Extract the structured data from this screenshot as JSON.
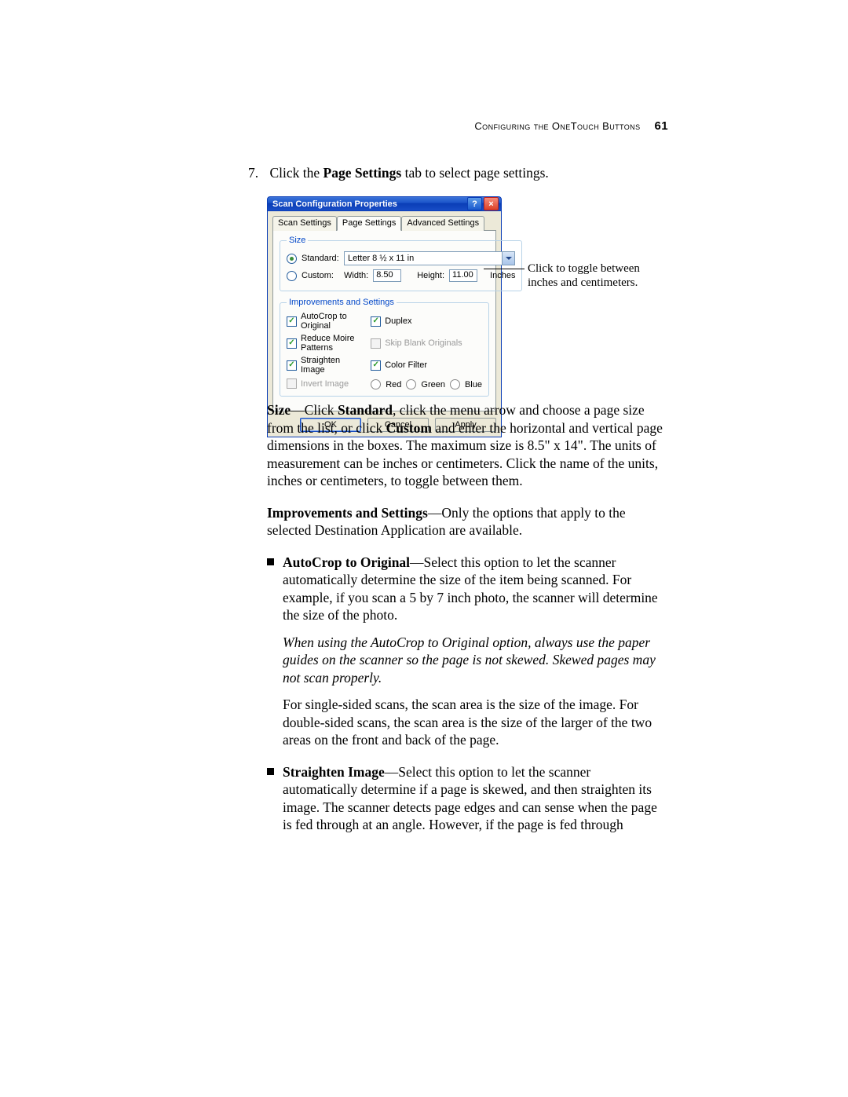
{
  "header": {
    "title": "Configuring the OneTouch Buttons",
    "page_number": "61"
  },
  "step": {
    "number": "7.",
    "text_before": "Click the ",
    "bold": "Page Settings",
    "text_after": " tab to select page settings."
  },
  "dialog": {
    "title": "Scan Configuration Properties",
    "tabs": {
      "scan": "Scan Settings",
      "page": "Page Settings",
      "advanced": "Advanced Settings"
    },
    "size": {
      "legend": "Size",
      "standard_label": "Standard:",
      "standard_value": "Letter 8 ½ x 11 in",
      "custom_label": "Custom:",
      "width_label": "Width:",
      "width_value": "8.50",
      "height_label": "Height:",
      "height_value": "11.00",
      "units": "Inches"
    },
    "improvements": {
      "legend": "Improvements and Settings",
      "autocrop": "AutoCrop to Original",
      "moire": "Reduce Moire Patterns",
      "straighten": "Straighten Image",
      "invert": "Invert Image",
      "duplex": "Duplex",
      "skip_blank": "Skip Blank Originals",
      "color_filter": "Color Filter",
      "red": "Red",
      "green": "Green",
      "blue": "Blue"
    },
    "buttons": {
      "ok": "OK",
      "cancel": "Cancel",
      "apply": "Apply"
    }
  },
  "callout": "Click to toggle between inches and centimeters.",
  "para_size": {
    "b1": "Size",
    "t1": "—Click ",
    "b2": "Standard",
    "t2": ", click the menu arrow and choose a page size from the list, or click ",
    "b3": "Custom",
    "t3": " and enter the horizontal and vertical page dimensions in the boxes. The maximum size is 8.5\" x 14\". The units of measurement can be inches or centimeters. Click the name of the units, inches or centimeters, to toggle between them."
  },
  "para_imp": {
    "b1": "Improvements and Settings",
    "t1": "—Only the options that apply to the selected Destination Application are available."
  },
  "bullet_autocrop": {
    "b1": "AutoCrop to Original",
    "t1": "—Select this option to let the scanner automatically determine the size of the item being scanned. For example, if you scan a 5 by 7 inch photo, the scanner will determine the size of the photo.",
    "italic": "When using the AutoCrop to Original option, always use the paper guides on the scanner so the page is not skewed. Skewed pages may not scan properly.",
    "t2": "For single-sided scans, the scan area is the size of the image. For double-sided scans, the scan area is the size of the larger of the two areas on the front and back of the page."
  },
  "bullet_straighten": {
    "b1": "Straighten Image",
    "t1": "—Select this option to let the scanner automatically determine if a page is skewed, and then straighten its image. The scanner detects page edges and can sense when the page is fed through at an angle. However, if the page is fed through"
  }
}
